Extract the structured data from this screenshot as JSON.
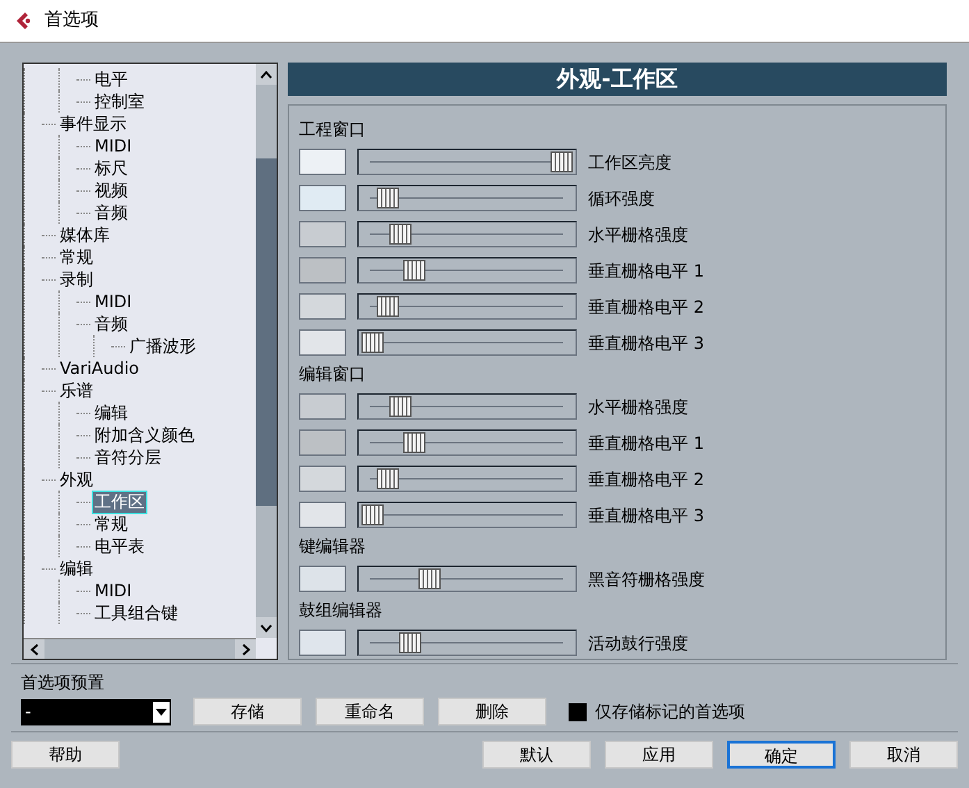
{
  "window": {
    "title": "首选项"
  },
  "tree": [
    {
      "children": [
        {
          "label": "电平",
          "selected": false
        },
        {
          "label": "控制室",
          "selected": false
        }
      ]
    },
    {
      "label": "事件显示",
      "selected": false,
      "children": [
        {
          "label": "MIDI",
          "selected": false
        },
        {
          "label": "标尺",
          "selected": false
        },
        {
          "label": "视频",
          "selected": false
        },
        {
          "label": "音频",
          "selected": false
        }
      ]
    },
    {
      "label": "媒体库",
      "selected": false
    },
    {
      "label": "常规",
      "selected": false
    },
    {
      "label": "录制",
      "selected": false,
      "children": [
        {
          "label": "MIDI",
          "selected": false
        },
        {
          "label": "音频",
          "selected": false,
          "children": [
            {
              "label": "广播波形",
              "selected": false
            }
          ]
        }
      ]
    },
    {
      "label": "VariAudio",
      "selected": false
    },
    {
      "label": "乐谱",
      "selected": false,
      "children": [
        {
          "label": "编辑",
          "selected": false
        },
        {
          "label": "附加含义颜色",
          "selected": false
        },
        {
          "label": "音符分层",
          "selected": false
        }
      ]
    },
    {
      "label": "外观",
      "selected": false,
      "children": [
        {
          "label": "工作区",
          "selected": true
        },
        {
          "label": "常规",
          "selected": false
        },
        {
          "label": "电平表",
          "selected": false
        }
      ]
    },
    {
      "label": "编辑",
      "selected": false,
      "children": [
        {
          "label": "MIDI",
          "selected": false
        },
        {
          "label": "工具组合键",
          "selected": false
        }
      ]
    }
  ],
  "page_title": "外观-工作区",
  "sections": [
    {
      "title": "工程窗口",
      "rows": [
        {
          "label": "工作区亮度",
          "color": "#edf1f5",
          "level": 1.0
        },
        {
          "label": "循环强度",
          "color": "#e0ebf3",
          "level": 0.08
        },
        {
          "label": "水平栅格强度",
          "color": "#c8ccd1",
          "level": 0.15
        },
        {
          "label": "垂直栅格电平 1",
          "color": "#bcc0c4",
          "level": 0.22
        },
        {
          "label": "垂直栅格电平 2",
          "color": "#d4d8dc",
          "level": 0.08
        },
        {
          "label": "垂直栅格电平 3",
          "color": "#e2e5e9",
          "level": 0.0
        }
      ]
    },
    {
      "title": "编辑窗口",
      "rows": [
        {
          "label": "水平栅格强度",
          "color": "#c8ccd1",
          "level": 0.15
        },
        {
          "label": "垂直栅格电平 1",
          "color": "#bcc0c4",
          "level": 0.22
        },
        {
          "label": "垂直栅格电平 2",
          "color": "#d4d8dc",
          "level": 0.08
        },
        {
          "label": "垂直栅格电平 3",
          "color": "#e2e5e9",
          "level": 0.0
        }
      ]
    },
    {
      "title": "键编辑器",
      "rows": [
        {
          "label": "黑音符栅格强度",
          "color": "#dde3e9",
          "level": 0.3
        }
      ]
    },
    {
      "title": "鼓组编辑器",
      "rows": [
        {
          "label": "活动鼓行强度",
          "color": "#dfe5ec",
          "level": 0.2
        }
      ]
    }
  ],
  "presets": {
    "label": "首选项预置",
    "value": "-",
    "buttons": [
      "存储",
      "重命名",
      "删除"
    ],
    "checkbox": {
      "label": "仅存储标记的首选项",
      "checked": true
    }
  },
  "footer": {
    "left": [
      "帮助"
    ],
    "right": [
      {
        "label": "默认",
        "focused": false
      },
      {
        "label": "应用",
        "focused": false
      },
      {
        "label": "确定",
        "focused": true
      },
      {
        "label": "取消",
        "focused": false
      }
    ]
  }
}
